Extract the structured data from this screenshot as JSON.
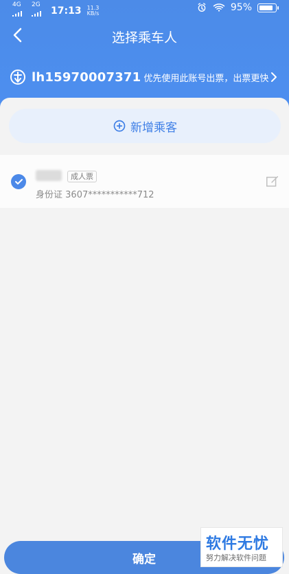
{
  "status": {
    "network": "4G",
    "network2": "2G",
    "time": "17:13",
    "speed_value": "11.3",
    "speed_unit": "KB/s",
    "battery": "95%"
  },
  "header": {
    "title": "选择乘车人"
  },
  "account": {
    "username": "lh15970007371",
    "tip": "优先使用此账号出票，出票更快"
  },
  "actions": {
    "add_passenger": "新增乘客",
    "confirm": "确定"
  },
  "passengers": [
    {
      "type_badge": "成人票",
      "id_label": "身份证",
      "id_number": "3607***********712"
    }
  ],
  "watermark": {
    "title": "软件无忧",
    "subtitle": "努力解决软件问题"
  },
  "colors": {
    "primary": "#4c8be8",
    "panel_bg": "#f3f3f3"
  },
  "icons": {
    "back": "back-icon",
    "rail": "rail-logo-icon",
    "chevron": "chevron-right-icon",
    "add": "add-circle-icon",
    "check": "checkmark-icon",
    "edit": "edit-icon"
  }
}
